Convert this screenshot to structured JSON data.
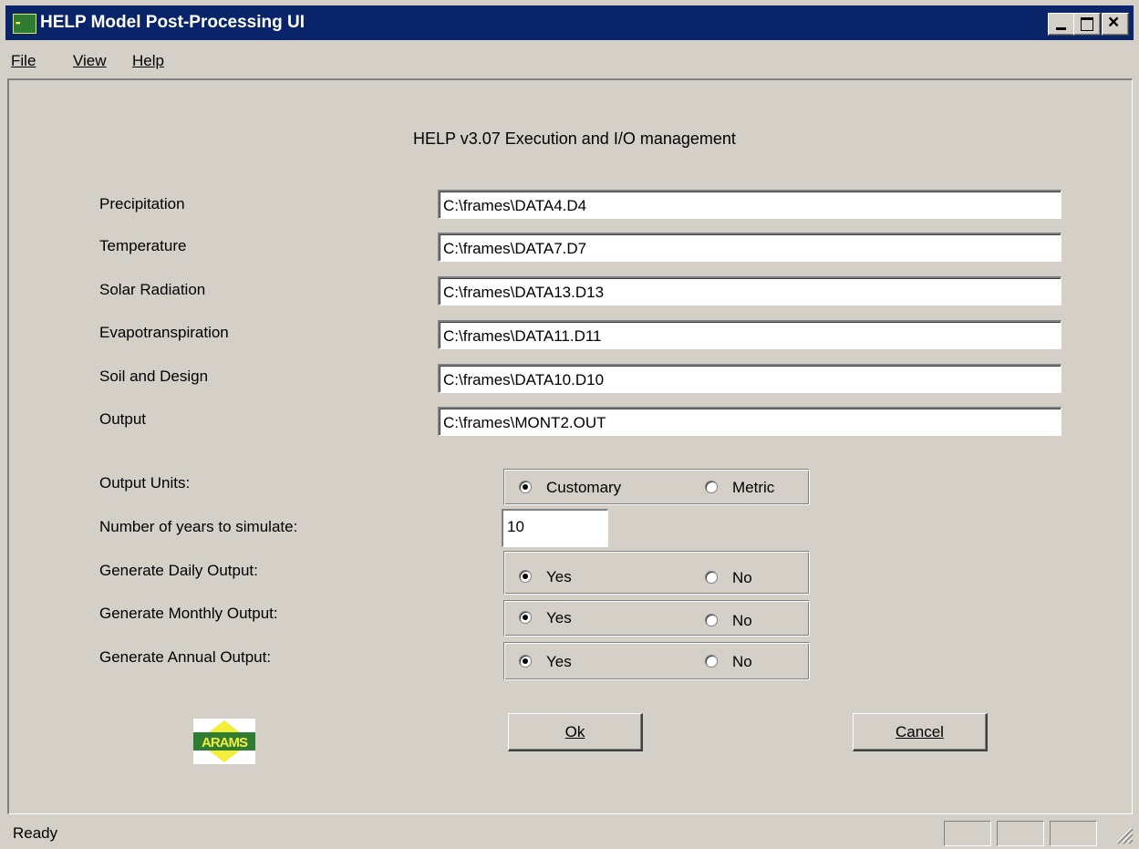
{
  "window": {
    "title": "HELP Model Post-Processing UI",
    "icon_name": "arams-app-icon"
  },
  "menu": {
    "file": "File",
    "view": "View",
    "help": "Help"
  },
  "heading": "HELP v3.07 Execution and I/O management",
  "fields": [
    {
      "label": "Precipitation",
      "value": "C:\\frames\\DATA4.D4"
    },
    {
      "label": "Temperature",
      "value": "C:\\frames\\DATA7.D7"
    },
    {
      "label": "Solar Radiation",
      "value": "C:\\frames\\DATA13.D13"
    },
    {
      "label": "Evapotranspiration",
      "value": "C:\\frames\\DATA11.D11"
    },
    {
      "label": "Soil and Design",
      "value": "C:\\frames\\DATA10.D10"
    },
    {
      "label": "Output",
      "value": "C:\\frames\\MONT2.OUT"
    }
  ],
  "output_units": {
    "label": "Output Units:",
    "options": [
      "Customary",
      "Metric"
    ],
    "selected": "Customary"
  },
  "years": {
    "label": "Number of years to simulate:",
    "value": "10"
  },
  "daily": {
    "label": "Generate Daily Output:",
    "options": [
      "Yes",
      "No"
    ],
    "selected": "Yes"
  },
  "monthly": {
    "label": "Generate Monthly Output:",
    "options": [
      "Yes",
      "No"
    ],
    "selected": "Yes"
  },
  "annual": {
    "label": "Generate Annual Output:",
    "options": [
      "Yes",
      "No"
    ],
    "selected": "Yes"
  },
  "buttons": {
    "ok": "Ok",
    "cancel": "Cancel"
  },
  "logo_text": "ARAMS",
  "status": "Ready",
  "colors": {
    "titlebar": "#0a246a",
    "face": "#d4d0c8",
    "logo_green": "#2f7d32",
    "logo_yellow": "#f2ee3a"
  }
}
